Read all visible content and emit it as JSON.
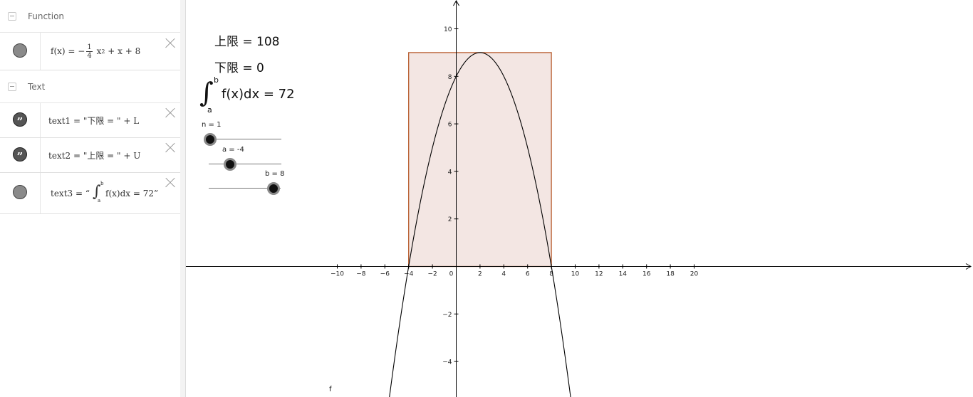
{
  "algebra": {
    "groups": [
      {
        "label": "Function",
        "items": [
          {
            "lhs": "f(x)",
            "eq": "=",
            "minus": "−",
            "frac_num": "1",
            "frac_den": "4",
            "x": "x",
            "exp": "2",
            "rest": "+ x + 8",
            "marble": "filled"
          }
        ]
      },
      {
        "label": "Text",
        "items": [
          {
            "expr": "text1 = \"下限 = \" + L",
            "marble": "quote"
          },
          {
            "expr": "text2 = \"上限 = \" + U",
            "marble": "quote"
          },
          {
            "lhs": "text3",
            "eq": "=",
            "open": "“",
            "upper": "b",
            "lower": "a",
            "body": "f(x)dx = 72”",
            "marble": "filled"
          }
        ]
      }
    ]
  },
  "graphics": {
    "upper_text": "上限 = 108",
    "lower_text": "下限 = 0",
    "integral": {
      "upper": "b",
      "lower": "a",
      "body": "f(x)dx = 72"
    },
    "sliders": [
      {
        "label": "n = 1",
        "value": 1
      },
      {
        "label": "a = -4",
        "value": -4
      },
      {
        "label": "b = 8",
        "value": 8
      }
    ],
    "curve_label": "f",
    "colors": {
      "rect_fill": "#f3e6e3",
      "rect_stroke": "#b85c2e",
      "curve": "#000000",
      "axis": "#000000"
    }
  },
  "chart_data": {
    "type": "line",
    "function": "f(x) = -1/4 x^2 + x + 8",
    "x_ticks": [
      -10,
      -8,
      -6,
      -4,
      -2,
      0,
      2,
      4,
      6,
      8,
      10,
      12,
      14,
      16,
      18,
      20
    ],
    "y_ticks": [
      -4,
      -2,
      2,
      4,
      6,
      8,
      10
    ],
    "x_tick_labels": [
      "−10",
      "−8",
      "−6",
      "−4",
      "−2",
      "0",
      "2",
      "4",
      "6",
      "8",
      "10",
      "12",
      "14",
      "16",
      "18",
      "20"
    ],
    "y_tick_labels": [
      "−4",
      "−2",
      "2",
      "4",
      "6",
      "8",
      "10"
    ],
    "xlim": [
      -11.3,
      21.8
    ],
    "ylim": [
      -5.5,
      11.2
    ],
    "rectangle": {
      "x_from": -4,
      "x_to": 8,
      "height": 9
    },
    "grid": false
  }
}
